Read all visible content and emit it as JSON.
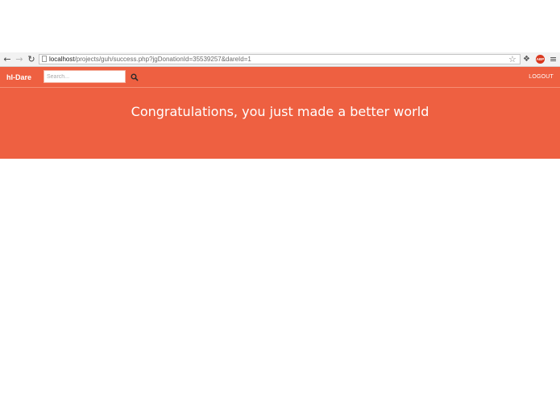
{
  "browser": {
    "url_host": "localhost",
    "url_path": "/projects/guh/success.php?jgDonationId=35539257&dareId=1",
    "back_icon": "arrow-left-icon",
    "forward_icon": "arrow-right-icon",
    "reload_icon": "reload-icon",
    "bookmark_icon": "star-icon",
    "extension_icon": "puzzle-icon",
    "adblock_label": "ABP",
    "menu_icon": "menu-icon"
  },
  "navbar": {
    "brand": "hI-Dare",
    "search_placeholder": "Search...",
    "search_icon": "search-icon",
    "logout_label": "LOGOUT",
    "background": "#ee6041"
  },
  "hero": {
    "title": "Congratulations, you just made a better world",
    "background": "#ee6041",
    "text_color": "#ffffff"
  }
}
